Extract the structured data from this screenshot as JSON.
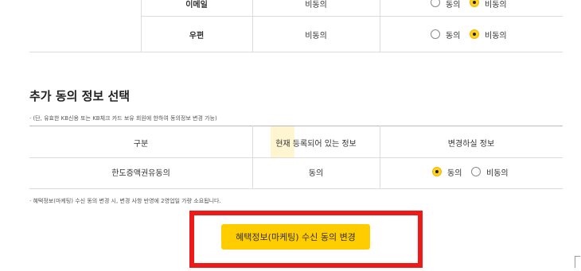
{
  "consent_table_top": {
    "rows": [
      {
        "channel": "이메일",
        "current": "비동의",
        "options": [
          "동의",
          "비동의"
        ],
        "selected": "비동의"
      },
      {
        "channel": "우편",
        "current": "비동의",
        "options": [
          "동의",
          "비동의"
        ],
        "selected": "비동의"
      }
    ]
  },
  "additional": {
    "title": "추가 동의 정보 선택",
    "note": "· (단, 유효한 KB신용 또는 KB체크 카드 보유 회원에 한하여 동의정보 변경 가능)",
    "headers": [
      "구분",
      "현재 등록되어 있는 정보",
      "변경하실 정보"
    ],
    "rows": [
      {
        "category": "한도증액권유동의",
        "current": "동의",
        "options": [
          "동의",
          "비동의"
        ],
        "selected": "동의"
      }
    ]
  },
  "footer_note": "· 혜택정보(마케팅) 수신 동의 변경 시, 변경 사항 반영에 2영업일 가량 소요됩니다.",
  "cta": {
    "label": "혜택정보(마케팅) 수신 동의 변경"
  },
  "colors": {
    "accent": "#ffcc00",
    "highlight": "#ee1a1a",
    "border": "#dcdcdc"
  }
}
